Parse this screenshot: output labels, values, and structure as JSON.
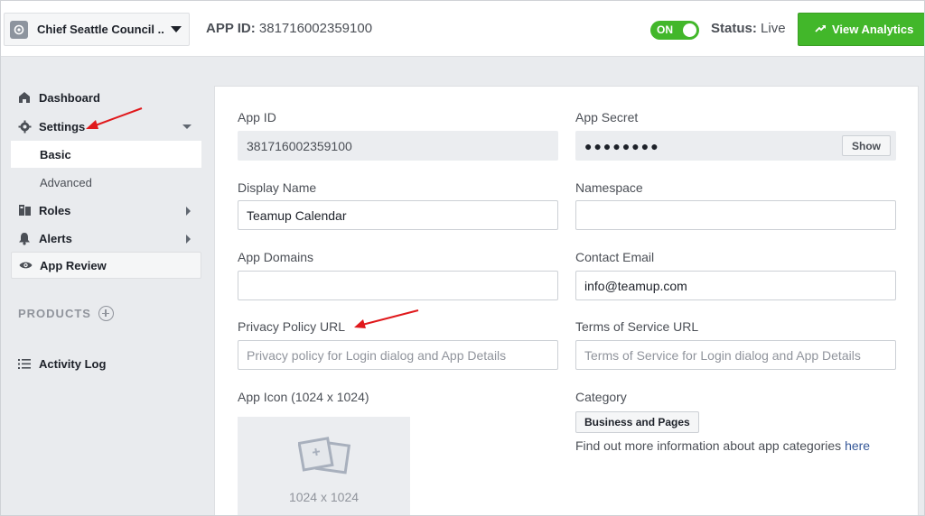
{
  "header": {
    "app_name": "Chief Seattle Council ...",
    "app_id_label": "APP ID:",
    "app_id_value": "381716002359100",
    "toggle_label": "ON",
    "status_label": "Status:",
    "status_value": "Live",
    "analytics_button": "View Analytics"
  },
  "sidebar": {
    "dashboard": "Dashboard",
    "settings": "Settings",
    "basic": "Basic",
    "advanced": "Advanced",
    "roles": "Roles",
    "alerts": "Alerts",
    "app_review": "App Review",
    "products": "PRODUCTS",
    "activity_log": "Activity Log"
  },
  "form": {
    "app_id_label": "App ID",
    "app_id_value": "381716002359100",
    "app_secret_label": "App Secret",
    "app_secret_value": "●●●●●●●●",
    "show_button": "Show",
    "display_name_label": "Display Name",
    "display_name_value": "Teamup Calendar",
    "namespace_label": "Namespace",
    "namespace_value": "",
    "app_domains_label": "App Domains",
    "app_domains_value": "",
    "contact_email_label": "Contact Email",
    "contact_email_value": "info@teamup.com",
    "privacy_label": "Privacy Policy URL",
    "privacy_placeholder": "Privacy policy for Login dialog and App Details",
    "terms_label": "Terms of Service URL",
    "terms_placeholder": "Terms of Service for Login dialog and App Details",
    "app_icon_label": "App Icon (1024 x 1024)",
    "app_icon_placeholder": "1024 x 1024",
    "category_label": "Category",
    "category_value": "Business and Pages",
    "category_info": "Find out more information about app categories ",
    "category_link": "here"
  },
  "colors": {
    "accent_green": "#42b72a",
    "annotation_red": "#e0191c",
    "link_blue": "#365899"
  }
}
